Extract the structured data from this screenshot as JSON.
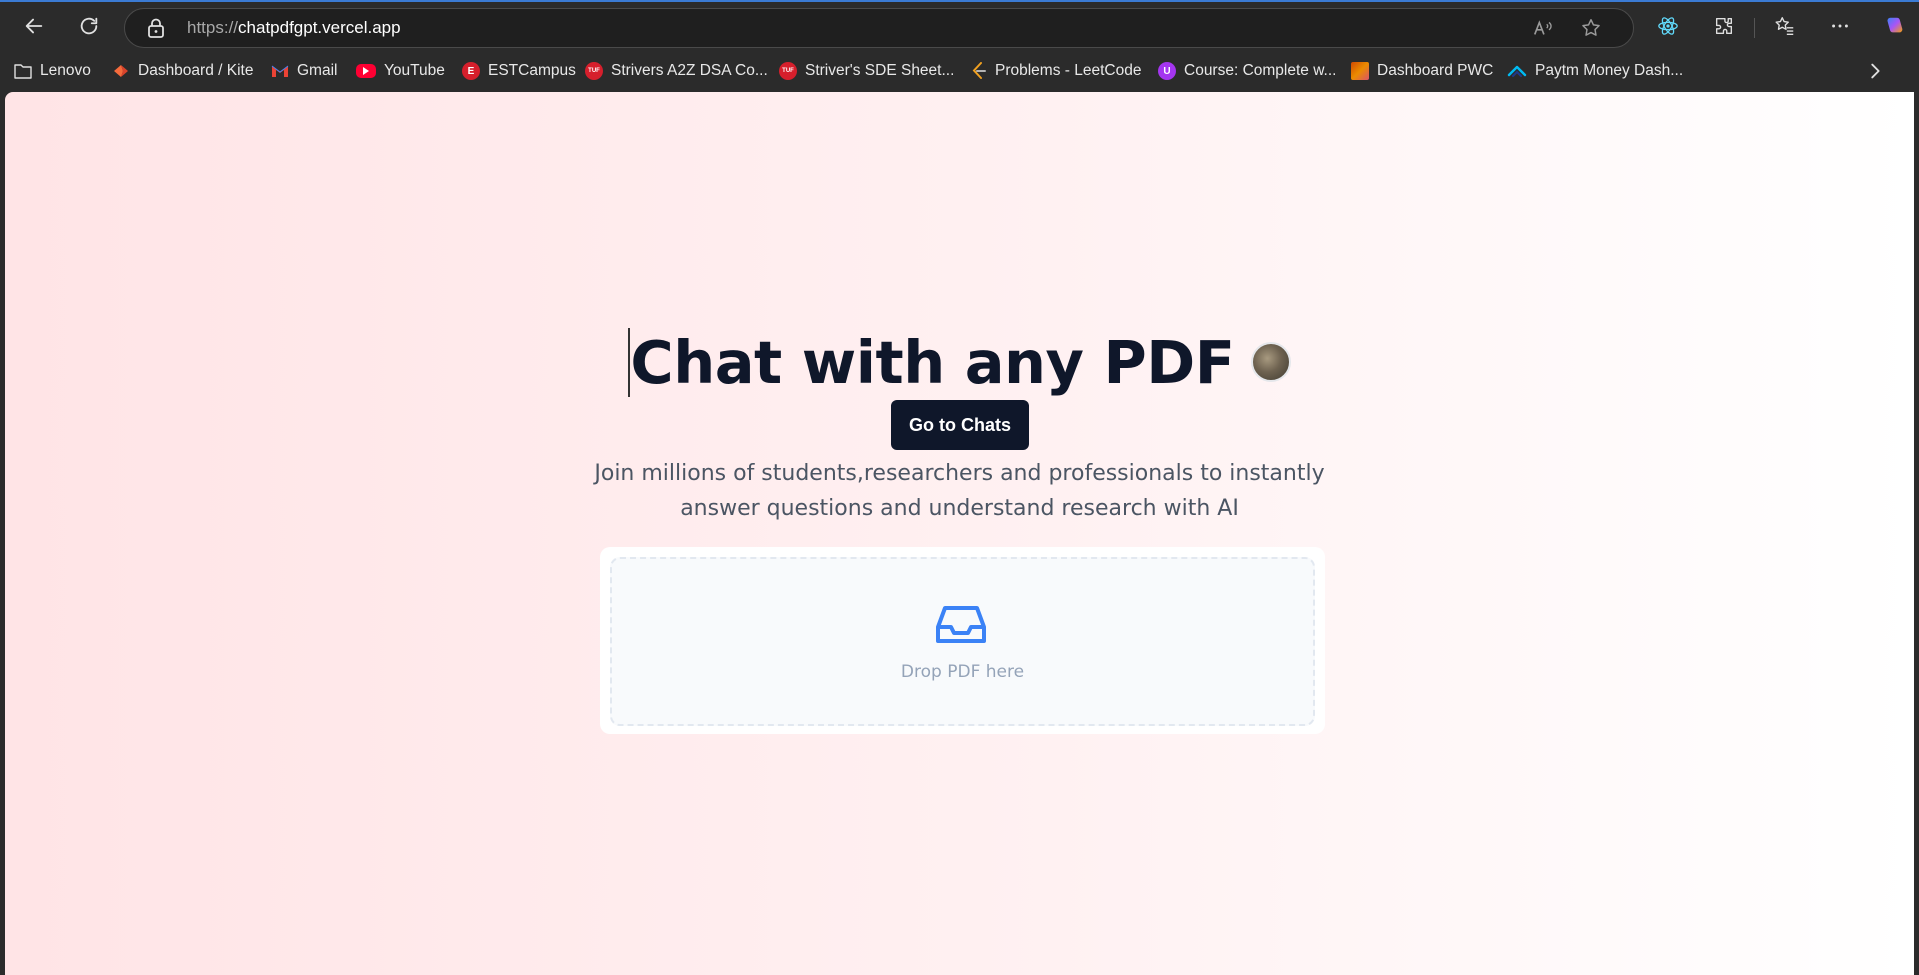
{
  "browser": {
    "url_protocol": "https://",
    "url_host": "chatpdfgpt.vercel.app"
  },
  "bookmarks": [
    {
      "label": "Lenovo",
      "icon": "folder-icon"
    },
    {
      "label": "Dashboard / Kite",
      "icon": "kite-icon"
    },
    {
      "label": "Gmail",
      "icon": "gmail-icon"
    },
    {
      "label": "YouTube",
      "icon": "youtube-icon"
    },
    {
      "label": "ESTCampus",
      "icon": "estcampus-icon"
    },
    {
      "label": "Strivers A2Z DSA Co...",
      "icon": "tuf-icon"
    },
    {
      "label": "Striver's SDE Sheet...",
      "icon": "tuf-icon"
    },
    {
      "label": "Problems - LeetCode",
      "icon": "leetcode-icon"
    },
    {
      "label": "Course: Complete w...",
      "icon": "udemy-icon"
    },
    {
      "label": "Dashboard PWC",
      "icon": "pwc-icon"
    },
    {
      "label": "Paytm Money Dash...",
      "icon": "paytm-icon"
    }
  ],
  "tuf_badge": "TUF",
  "hero": {
    "headline": "Chat with any PDF",
    "cta_label": "Go to Chats",
    "tagline": "Join millions of students,researchers and professionals to instantly answer questions and understand research with AI"
  },
  "dropzone": {
    "label": "Drop PDF here"
  },
  "colors": {
    "brand_dark": "#0f172a",
    "accent_blue": "#3b82f6",
    "page_gradient_start": "#ffe4e6"
  }
}
